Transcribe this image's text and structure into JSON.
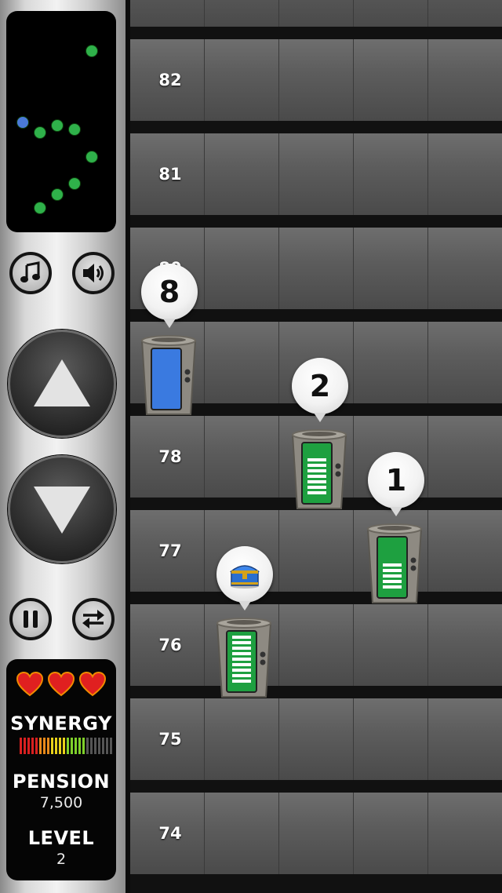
{
  "sidebar": {
    "minimap_dots": [
      {
        "color": "green"
      },
      {
        "color": "blue"
      },
      {
        "color": "green"
      },
      {
        "color": "green"
      },
      {
        "color": "green"
      },
      {
        "color": "green"
      },
      {
        "color": "green"
      },
      {
        "color": "green"
      },
      {
        "color": "green"
      }
    ],
    "controls": {
      "music_icon": "music-note-icon",
      "sound_icon": "speaker-icon",
      "up_icon": "up-arrow-icon",
      "down_icon": "down-arrow-icon",
      "pause_icon": "pause-icon",
      "swap_icon": "swap-arrows-icon"
    },
    "stats": {
      "lives": 3,
      "synergy_label": "SYNERGY",
      "synergy_level_fraction": 0.72,
      "pension_label": "PENSION",
      "pension_value": "7,500",
      "level_label": "LEVEL",
      "level_value": "2"
    }
  },
  "floors": [
    {
      "number": ""
    },
    {
      "number": "82"
    },
    {
      "number": "81"
    },
    {
      "number": "80"
    },
    {
      "number": ""
    },
    {
      "number": "78"
    },
    {
      "number": "77"
    },
    {
      "number": "76"
    },
    {
      "number": "75"
    },
    {
      "number": "74"
    }
  ],
  "elevators": [
    {
      "id": "elevator-8",
      "bubble": "8",
      "door_color": "blue"
    },
    {
      "id": "elevator-2",
      "bubble": "2",
      "door_color": "green"
    },
    {
      "id": "elevator-1",
      "bubble": "1",
      "door_color": "green"
    },
    {
      "id": "elevator-treasure",
      "bubble_icon": "treasure-chest-icon",
      "door_color": "green"
    }
  ],
  "colors": {
    "accent_green": "#2fb14a",
    "accent_blue": "#4a79d8",
    "heart_red": "#e02020"
  }
}
